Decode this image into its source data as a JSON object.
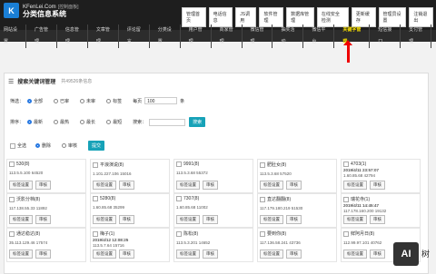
{
  "header": {
    "logo_mark": "K",
    "domain": "KFenLei.Com",
    "tag": "[控制面板]",
    "name": "分类信息系统",
    "top_links": [
      "管理首页",
      "电话信息",
      "JS调用",
      "软件管理",
      "数据库管理",
      "在线安全检测",
      "更新缓存",
      "管理员设置",
      "注销退出"
    ]
  },
  "nav": {
    "items": [
      "网站设置",
      "广告管理",
      "信息管理",
      "文章管理",
      "评论留言",
      "分类设置",
      "用户管理",
      "商家管理",
      "微信管理",
      "抽奖活动",
      "微信平台",
      "关键字管理",
      "短信接口",
      "支付管理"
    ],
    "active_index": 11
  },
  "panel": {
    "title": "搜索关键词管理",
    "count": "共49526条信息",
    "filter_label": "筛选：",
    "filter_options": [
      "全部",
      "已审",
      "未审",
      "标签"
    ],
    "per_page_label": "每页",
    "per_page_value": "100",
    "per_page_unit": "条",
    "sort_label": "排序：",
    "sort_options": [
      "最新",
      "最热",
      "最长",
      "最短"
    ],
    "search_label": "搜索：",
    "search_button": "搜索",
    "select_all": "全选",
    "delete_label": "删除",
    "review_label": "审核",
    "submit_button": "提交"
  },
  "cards": [
    {
      "name": "530(8)",
      "meta": "113.5.5.100 64520",
      "b1": "标签设置",
      "b2": "审核"
    },
    {
      "name": "平浪演说(8)",
      "meta": "1.101.227.106 15016",
      "b1": "标签设置",
      "b2": "审核"
    },
    {
      "name": "9991(8)",
      "meta": "113.5.3.68 55372",
      "b1": "标签设置",
      "b2": "审核"
    },
    {
      "name": "肥肚女(8)",
      "meta": "113.5.3.68 57520",
      "b1": "标签设置",
      "b2": "审核"
    },
    {
      "name": "4703(1)",
      "time": "2019/4/11 23:57:07",
      "meta": "1.60.85.68 42794",
      "b1": "标签设置",
      "b2": "审核"
    },
    {
      "name": "沃影分档(8)",
      "meta": "117.138.55.33 11892",
      "b1": "标签设置",
      "b2": "审核"
    },
    {
      "name": "5280(8)",
      "meta": "1.60.85.68 35299",
      "b1": "标签设置",
      "b2": "审核"
    },
    {
      "name": "7307(8)",
      "meta": "1.60.85.68 11002",
      "b1": "标签设置",
      "b2": "审核"
    },
    {
      "name": "直达翻翻(8)",
      "meta": "117.179.180.219 51530",
      "b1": "标签设置",
      "b2": "审核"
    },
    {
      "name": "瑞花寺(1)",
      "time": "2019/4/11 14:45:47",
      "meta": "117.178.160.200 19132",
      "b1": "标签设置",
      "b2": "审核"
    },
    {
      "name": "通达稳达(8)",
      "meta": "35.113.129.46 17574",
      "b1": "标签设置",
      "b2": "审核"
    },
    {
      "name": "梅子(1)",
      "time": "2019/4/12 12:08:25",
      "meta": "113.5.7.64 15716",
      "b1": "标签设置",
      "b2": "审核"
    },
    {
      "name": "陈松(8)",
      "meta": "113.5.3.201 14652",
      "b1": "标签设置",
      "b2": "审核"
    },
    {
      "name": "要到你(8)",
      "meta": "117.136.58.241 43736",
      "b1": "标签设置",
      "b2": "审核"
    },
    {
      "name": "鲜阿月日(8)",
      "meta": "112.99.97.101 40762",
      "b1": "标签设置",
      "b2": "审核"
    }
  ],
  "watermark": {
    "badge": "AI",
    "side": "树"
  }
}
